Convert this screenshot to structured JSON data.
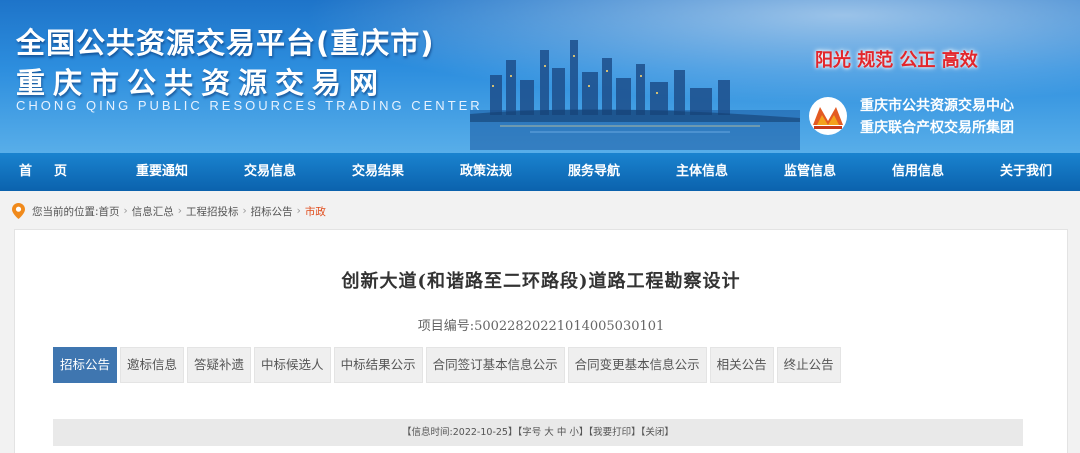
{
  "banner": {
    "title_line1": "全国公共资源交易平台(重庆市)",
    "title_line2": "重庆市公共资源交易网",
    "title_en": "CHONG QING PUBLIC RESOURCES TRADING CENTER",
    "slogan": "阳光  规范  公正  高效",
    "org_line1": "重庆市公共资源交易中心",
    "org_line2": "重庆联合产权交易所集团"
  },
  "nav": {
    "items": [
      "首页",
      "重要通知",
      "交易信息",
      "交易结果",
      "政策法规",
      "服务导航",
      "主体信息",
      "监管信息",
      "信用信息",
      "关于我们"
    ]
  },
  "breadcrumb": {
    "prefix": "您当前的位置:",
    "items": [
      "首页",
      "信息汇总",
      "工程招投标",
      "招标公告",
      "市政"
    ]
  },
  "project": {
    "title": "创新大道(和谐路至二环路段)道路工程勘察设计",
    "number_label": "项目编号:",
    "number": "500228202210140050301​01"
  },
  "tabs": [
    "招标公告",
    "邀标信息",
    "答疑补遗",
    "中标候选人",
    "中标结果公示",
    "合同签订基本信息公示",
    "合同变更基本信息公示",
    "相关公告",
    "终止公告"
  ],
  "infobar": {
    "date_prefix": "【信息时间:",
    "date": "2022-10-25",
    "date_suffix": "】",
    "font_label": "【字号",
    "font_large": "大",
    "font_medium": "中",
    "font_small": "小",
    "font_close": "】",
    "print": "【我要打印】",
    "close": "【关闭】"
  },
  "colors": {
    "nav_bg": "#0b62ad",
    "tab_active": "#3f76b0",
    "slogan": "#e3262b",
    "breadcrumb_current": "#e04b1a"
  },
  "icons": {
    "location": "map-pin-icon",
    "logo": "org-logo-icon"
  }
}
